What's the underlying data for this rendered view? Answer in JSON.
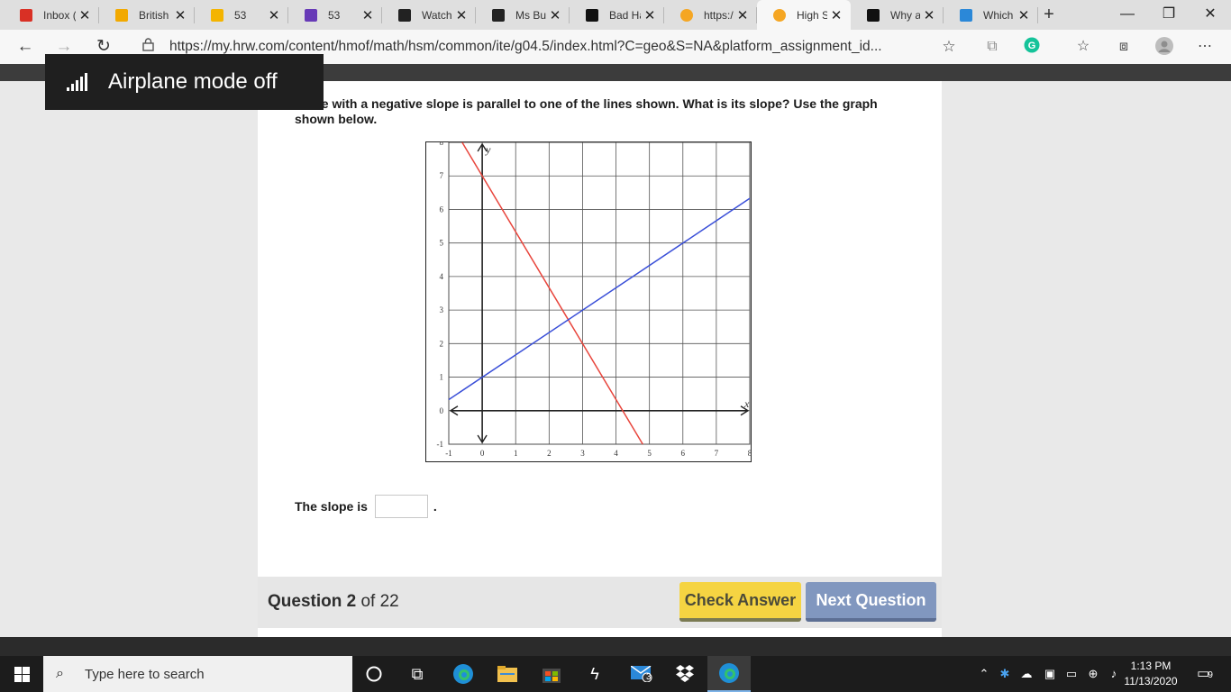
{
  "browser": {
    "tabs": [
      {
        "title": "Inbox (",
        "icon": "gmail-icon",
        "color": "#d93025"
      },
      {
        "title": "British",
        "icon": "palm-tree-icon",
        "color": "#f2a900"
      },
      {
        "title": "53",
        "icon": "classroom-icon",
        "color": "#f4b400"
      },
      {
        "title": "53",
        "icon": "forms-icon",
        "color": "#673ab7"
      },
      {
        "title": "Watch",
        "icon": "t-logo-icon",
        "color": "#222222"
      },
      {
        "title": "Ms Bur",
        "icon": "contact-card-icon",
        "color": "#222222"
      },
      {
        "title": "Bad Ha",
        "icon": "chevrons-logo-icon",
        "color": "#111111"
      },
      {
        "title": "https:/",
        "icon": "orange-dot-icon",
        "color": "#f5a623"
      },
      {
        "title": "High S",
        "icon": "orange-dot-icon",
        "color": "#f5a623",
        "active": true
      },
      {
        "title": "Why ar",
        "icon": "b-logo-icon",
        "color": "#111111"
      },
      {
        "title": "Which",
        "icon": "bing-icon",
        "color": "#2b88d8"
      }
    ],
    "new_tab": "+",
    "window": {
      "minimize": "—",
      "restore": "❐",
      "close": "✕"
    },
    "url": "https://my.hrw.com/content/hmof/math/hsm/common/ite/g04.5/index.html?C=geo&S=NA&platform_assignment_id..."
  },
  "toast": {
    "text": "Airplane mode off",
    "icon": "signal-bars-icon"
  },
  "content": {
    "question": "A line with a negative slope is parallel to one of the lines shown. What is its slope? Use the graph shown below.",
    "answer_prefix": "The slope is",
    "answer_suffix": ".",
    "answer_value": ""
  },
  "footer": {
    "question_label": "Question",
    "question_number": "2",
    "of_label": "of 22",
    "check_label": "Check Answer",
    "next_label": "Next Question"
  },
  "chart_data": {
    "type": "line",
    "xlim": [
      -1,
      8
    ],
    "ylim": [
      -1,
      8
    ],
    "x_ticks": [
      "-1",
      "0",
      "1",
      "2",
      "3",
      "4",
      "5",
      "6",
      "7",
      "8"
    ],
    "y_ticks": [
      "-1",
      "0",
      "1",
      "2",
      "3",
      "4",
      "5",
      "6",
      "7",
      "8"
    ],
    "xlabel": "x",
    "ylabel": "y",
    "grid": true,
    "series": [
      {
        "color": "#e8453c",
        "points": [
          [
            -0.6,
            8
          ],
          [
            4.8,
            -1
          ]
        ]
      },
      {
        "color": "#3a4fd8",
        "points": [
          [
            -1,
            0.33
          ],
          [
            8,
            6.33
          ]
        ]
      }
    ]
  },
  "taskbar": {
    "search_placeholder": "Type here to search",
    "mail_badge": "3",
    "time": "1:13 PM",
    "date": "11/13/2020",
    "notifications": "9"
  }
}
